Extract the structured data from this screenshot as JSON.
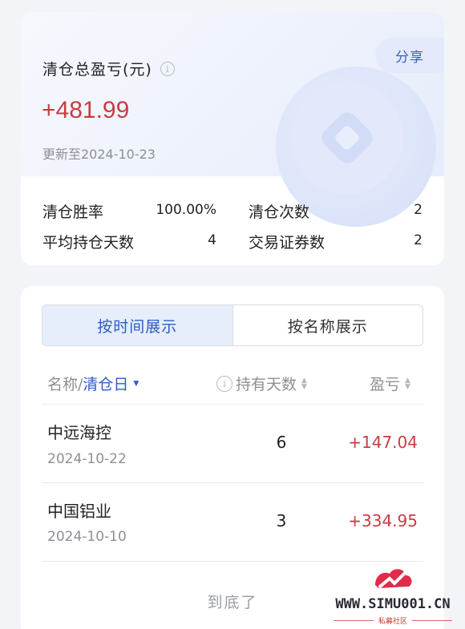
{
  "summary": {
    "title": "清仓总盈亏(元)",
    "info_glyph": "i",
    "share_label": "分享",
    "pnl": "+481.99",
    "updated": "更新至2024-10-23",
    "stats": [
      {
        "label": "清仓胜率",
        "value": "100.00%"
      },
      {
        "label": "清仓次数",
        "value": "2"
      },
      {
        "label": "平均持仓天数",
        "value": "4"
      },
      {
        "label": "交易证券数",
        "value": "2"
      }
    ]
  },
  "list": {
    "tabs": [
      {
        "label": "按时间展示",
        "active": true
      },
      {
        "label": "按名称展示",
        "active": false
      }
    ],
    "headers": {
      "name_prefix": "名称/",
      "name_sorted": "清仓日",
      "days": "持有天数",
      "pnl": "盈亏"
    },
    "rows": [
      {
        "name": "中远海控",
        "date": "2024-10-22",
        "days": "6",
        "pnl": "+147.04"
      },
      {
        "name": "中国铝业",
        "date": "2024-10-10",
        "days": "3",
        "pnl": "+334.95"
      }
    ],
    "end_note": "到底了"
  },
  "watermark": {
    "text": "WWW.SIMU001.CN",
    "sub": "私募社区"
  },
  "colors": {
    "accent": "#2d5bc4",
    "profit": "#c93c43",
    "background": "#f3f4f8"
  }
}
